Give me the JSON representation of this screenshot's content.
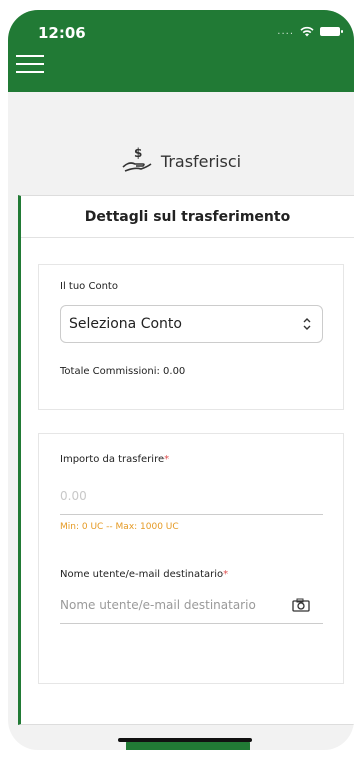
{
  "status_bar": {
    "time": "12:06",
    "signal": "....",
    "wifi_icon": "wifi-icon",
    "battery_icon": "battery-icon"
  },
  "header": {
    "menu_icon": "hamburger-menu-icon",
    "color": "#217a35"
  },
  "page": {
    "title": "Trasferisci",
    "icon": "money-hand-icon"
  },
  "card": {
    "title": "Dettagli sul trasferimento"
  },
  "account_section": {
    "label": "Il tuo Conto",
    "select_value": "Seleziona Conto",
    "commission": "Totale Commissioni: 0.00"
  },
  "transfer_section": {
    "amount_label": "Importo da trasferire",
    "amount_required": "*",
    "amount_placeholder": "0.00",
    "range": "Min: 0 UC -- Max: 1000 UC",
    "recipient_label": "Nome utente/e-mail destinatario",
    "recipient_required": "*",
    "recipient_placeholder": "Nome utente/e-mail destinatario",
    "camera_icon": "camera-icon"
  },
  "colors": {
    "primary": "#217a35",
    "warning": "#e59a24",
    "required": "#e05050"
  }
}
